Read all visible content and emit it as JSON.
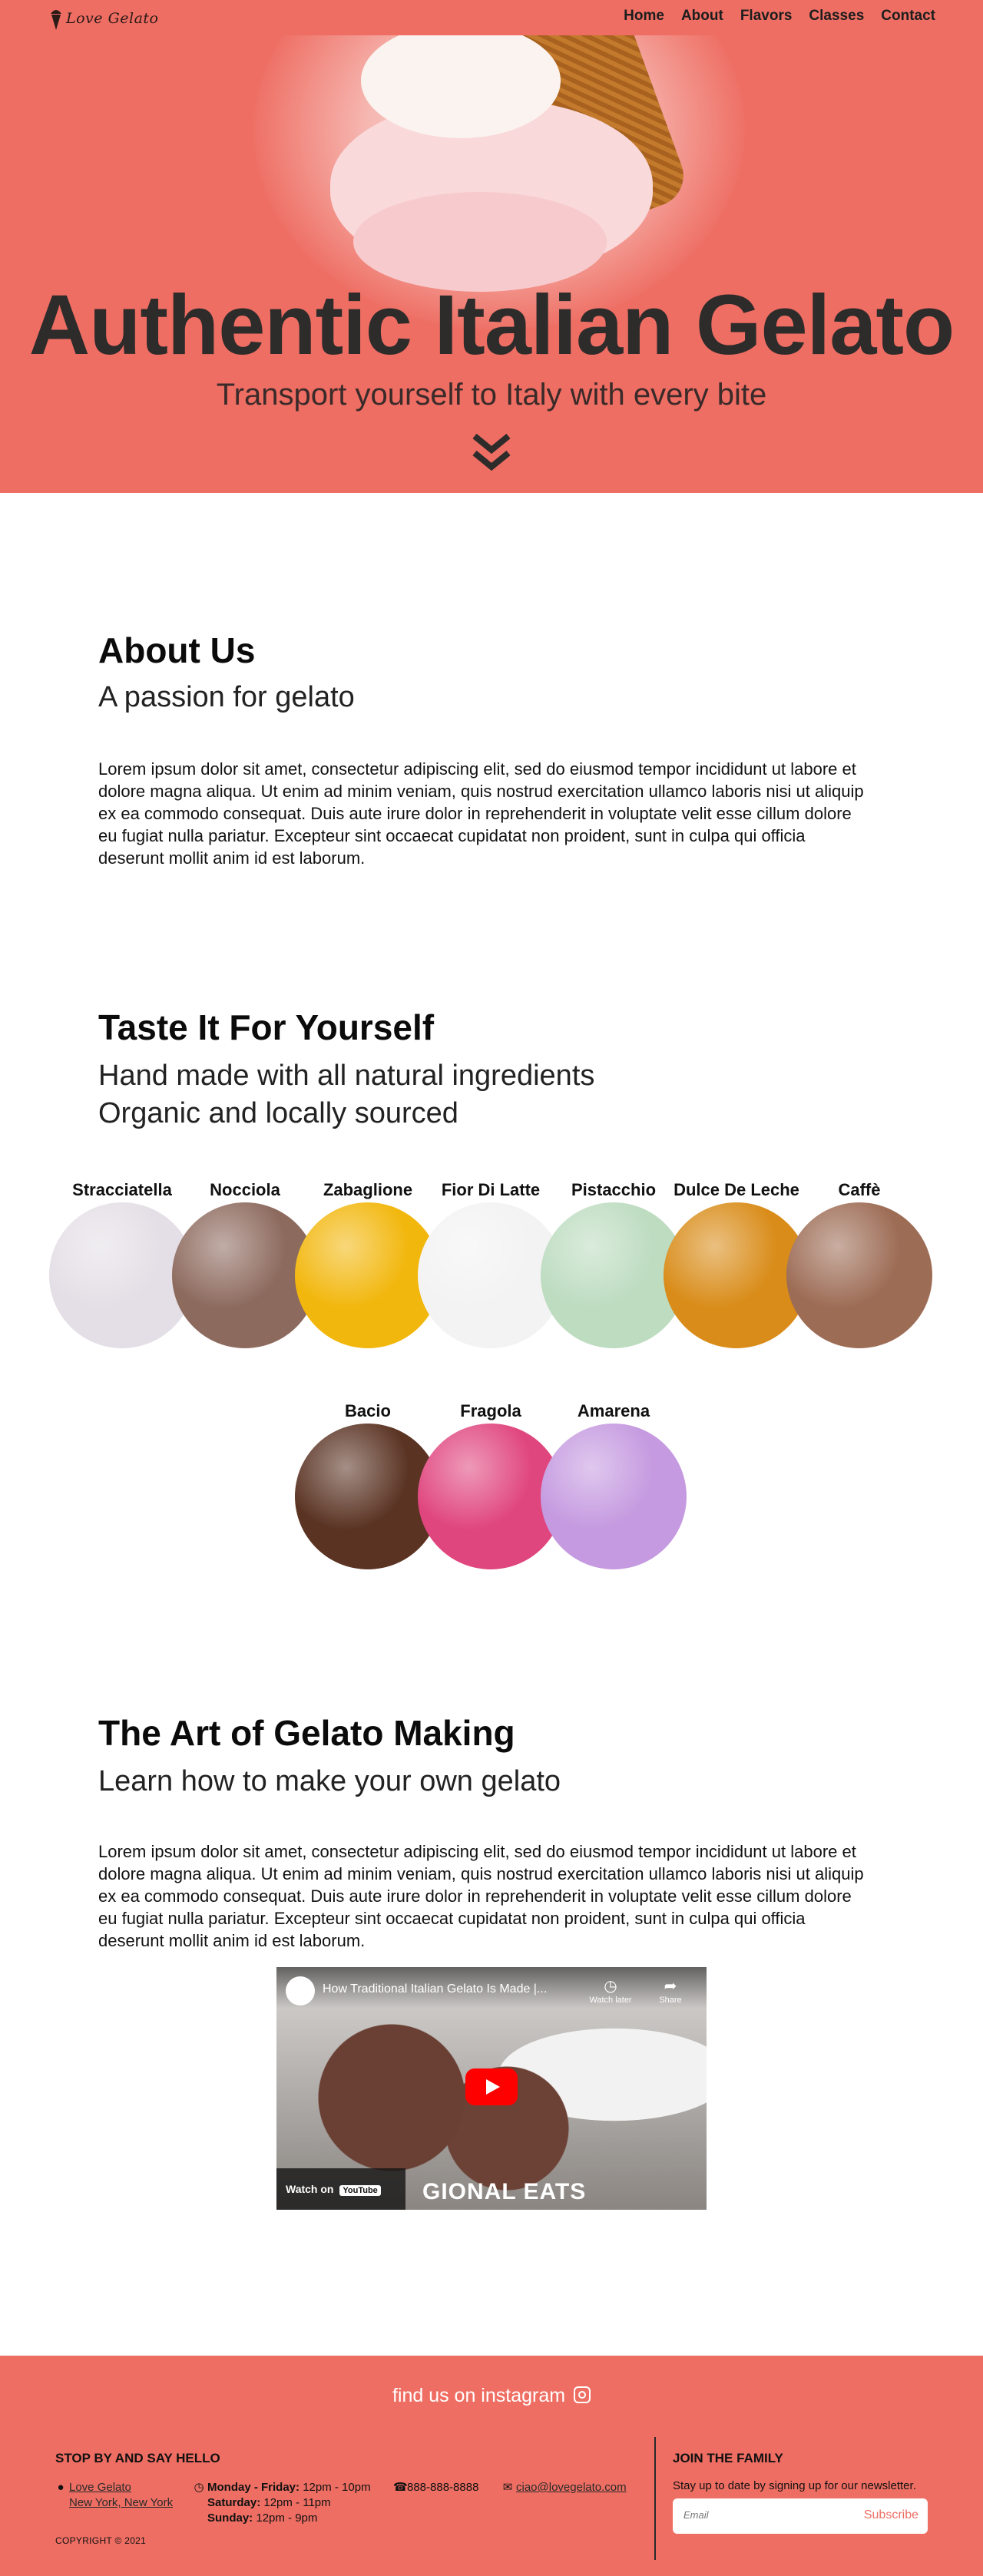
{
  "nav": {
    "logo_text": "Love Gelato",
    "links": [
      "Home",
      "About",
      "Flavors",
      "Classes",
      "Contact"
    ]
  },
  "hero": {
    "title": "Authentic Italian Gelato",
    "subtitle": "Transport yourself to Italy with every bite"
  },
  "about": {
    "title": "About Us",
    "subtitle": "A passion for gelato",
    "body": "Lorem ipsum dolor sit amet, consectetur adipiscing elit, sed do eiusmod tempor incididunt ut labore et dolore magna aliqua. Ut enim ad minim veniam, quis nostrud exercitation ullamco laboris nisi ut aliquip ex ea commodo consequat. Duis aute irure dolor in reprehenderit in voluptate velit esse cillum dolore eu fugiat nulla pariatur. Excepteur sint occaecat cupidatat non proident, sunt in culpa qui officia deserunt mollit anim id est laborum."
  },
  "taste": {
    "title": "Taste It For Yourself",
    "subtitle_line1": "Hand made with all natural ingredients",
    "subtitle_line2": "Organic and locally sourced",
    "flavors": [
      {
        "name": "Stracciatella",
        "color": "#e4dfe6"
      },
      {
        "name": "Nocciola",
        "color": "#8d6a5e"
      },
      {
        "name": "Zabaglione",
        "color": "#f2b70d"
      },
      {
        "name": "Fior Di Latte",
        "color": "#f3f3f3"
      },
      {
        "name": "Pistacchio",
        "color": "#bddcc0"
      },
      {
        "name": "Dulce De Leche",
        "color": "#d98c19"
      },
      {
        "name": "Caffè",
        "color": "#9d6c55"
      },
      {
        "name": "Bacio",
        "color": "#5a3323"
      },
      {
        "name": "Fragola",
        "color": "#e0467e"
      },
      {
        "name": "Amarena",
        "color": "#c59ae0"
      }
    ]
  },
  "art": {
    "title": "The Art of Gelato Making",
    "subtitle": "Learn how to make your own gelato",
    "body": "Lorem ipsum dolor sit amet, consectetur adipiscing elit, sed do eiusmod tempor incididunt ut labore et dolore magna aliqua. Ut enim ad minim veniam, quis nostrud exercitation ullamco laboris nisi ut aliquip ex ea commodo consequat. Duis aute irure dolor in reprehenderit in voluptate velit esse cillum dolore eu fugiat nulla pariatur. Excepteur sint occaecat cupidatat non proident, sunt in culpa qui officia deserunt mollit anim id est laborum."
  },
  "video": {
    "title": "How Traditional Italian Gelato Is Made |...",
    "watch_later": "Watch later",
    "share": "Share",
    "watch_on": "Watch on",
    "youtube": "YouTube",
    "brand_text": "GIONAL EATS"
  },
  "footer": {
    "instagram": "find us on instagram",
    "hello_heading": "STOP BY AND SAY HELLO",
    "address_line1": "Love Gelato",
    "address_line2": "New York, New York",
    "hours": [
      {
        "days": "Monday - Friday:",
        "time": "12pm - 10pm"
      },
      {
        "days": "Saturday:",
        "time": "12pm - 11pm"
      },
      {
        "days": "Sunday:",
        "time": "12pm - 9pm"
      }
    ],
    "phone": "888-888-8888",
    "email": "ciao@lovegelato.com",
    "family_heading": "JOIN THE FAMILY",
    "family_text": "Stay up to date by signing up for our newsletter.",
    "email_placeholder": "Email",
    "subscribe": "Subscribe",
    "copyright": "COPYRIGHT © 2021"
  },
  "colors": {
    "brand": "#ee6e63",
    "text_dark": "#2e2b2b"
  }
}
